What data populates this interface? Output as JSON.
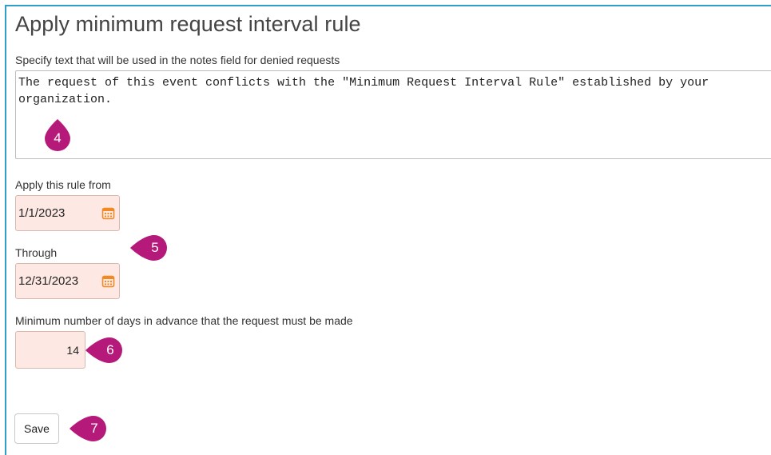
{
  "form": {
    "title": "Apply minimum request interval rule",
    "notes_label": "Specify text that will be used in the notes field for denied requests",
    "notes_value": "The request of this event conflicts with the \"Minimum Request Interval Rule\" established by your organization.",
    "from_label": "Apply this rule from",
    "from_value": "1/1/2023",
    "through_label": "Through",
    "through_value": "12/31/2023",
    "days_label": "Minimum number of days in advance that the request must be made",
    "days_value": "14",
    "save_label": "Save"
  },
  "callouts": {
    "c4": "4",
    "c5": "5",
    "c6": "6",
    "c7": "7"
  },
  "colors": {
    "frame_border": "#2f9ec9",
    "callout": "#b5197a",
    "input_required_bg": "#fde8e3",
    "calendar_icon": "#f08a24"
  },
  "icons": {
    "calendar": "calendar-icon"
  }
}
